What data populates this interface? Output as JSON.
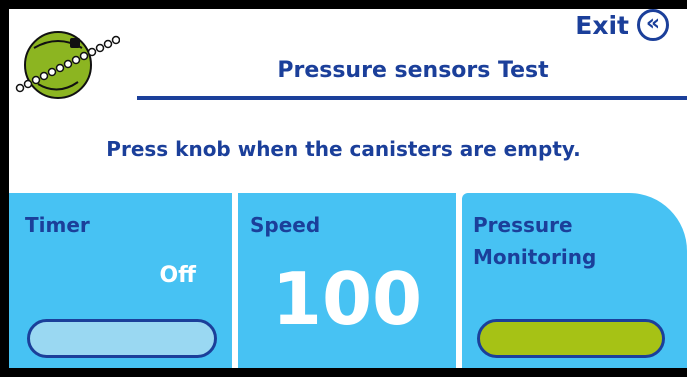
{
  "header": {
    "exit_label": "Exit",
    "exit_icon": "«",
    "title": "Pressure sensors Test"
  },
  "instruction": "Press knob when the canisters are empty.",
  "panels": {
    "timer": {
      "label": "Timer",
      "value": "Off"
    },
    "speed": {
      "label": "Speed",
      "value": "100"
    },
    "pressure": {
      "label_line1": "Pressure",
      "label_line2": "Monitoring"
    }
  },
  "colors": {
    "text_blue": "#1b3f9a",
    "panel_blue": "#47c2f3",
    "timer_bar": "#9ad8f2",
    "pressure_bar": "#a6c215",
    "logo_green": "#8cb521"
  },
  "icons": {
    "logo": "roller-pump-logo-icon",
    "exit": "double-chevron-left-icon"
  }
}
